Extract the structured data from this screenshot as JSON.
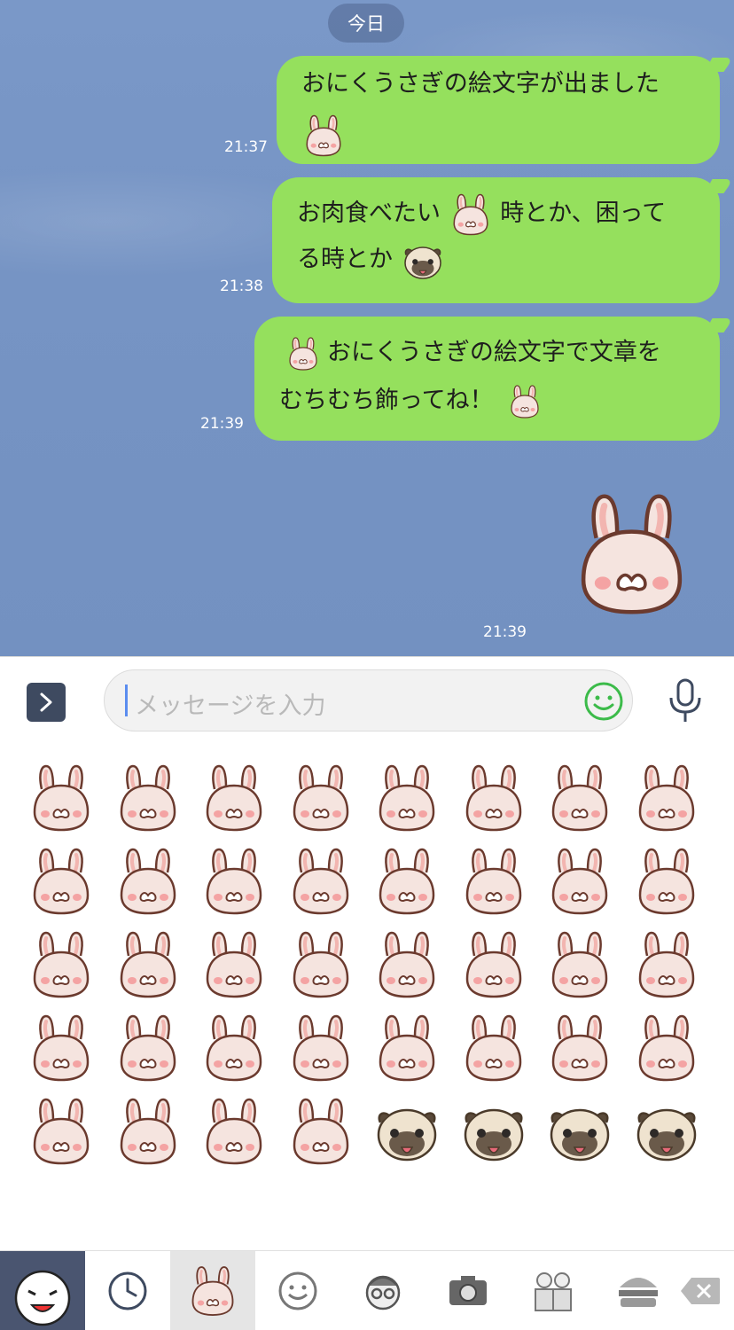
{
  "chat": {
    "date_label": "今日",
    "messages": [
      {
        "line1": "おにくうさぎの絵文字が出ました",
        "time": "21:37"
      },
      {
        "line1a": "お肉食べたい",
        "line1b": "時とか、困って",
        "line2": "る時とか",
        "time": "21:38"
      },
      {
        "line1": "おにくうさぎの絵文字で文章を",
        "line2": "むちむち飾ってね！",
        "time": "21:39"
      },
      {
        "sticker": "bunny-sticker",
        "time": "21:39"
      }
    ]
  },
  "input": {
    "placeholder": "メッセージを入力",
    "expand_icon": "chevron-right-icon",
    "emoji_icon": "smile-icon",
    "mic_icon": "microphone-icon"
  },
  "emoji_grid": {
    "rows": [
      [
        "bunny-plain",
        "bunny-blush",
        "bunny-flowers",
        "bunny-sparkle",
        "bunny-stars",
        "bunny-hug",
        "bunny-tongue",
        "bunny-sleep"
      ],
      [
        "bunny-neutral",
        "bunny-steam",
        "bunny-angry",
        "bunny-punch",
        "bunny-sweat",
        "bunny-drop",
        "bunny-cry",
        "bunny-tears"
      ],
      [
        "bunny-star-tilt",
        "bunny-pow",
        "bunny-shock",
        "bunny-halo",
        "bunny-smug",
        "bunny-dash",
        "bunny-thumb",
        "bunny-peek"
      ],
      [
        "bunny-calm",
        "bunny-soul",
        "bunny-gloom",
        "bunny-lying",
        "bunny-sunglasses",
        "bunny-meat",
        "bunny-run",
        "bunny-roll"
      ],
      [
        "bunny-exclaim",
        "bunny-question",
        "bunny-flop",
        "bunny-sprawl",
        "pug-tongue",
        "pug-halo",
        "pug-shiver",
        "pug-question"
      ]
    ]
  },
  "tabs": [
    {
      "name": "tab-sticker-character",
      "icon": "character-face-icon"
    },
    {
      "name": "tab-recent",
      "icon": "clock-icon"
    },
    {
      "name": "tab-bunny",
      "icon": "bunny-icon"
    },
    {
      "name": "tab-smiley",
      "icon": "smiley-icon"
    },
    {
      "name": "tab-people",
      "icon": "face-glasses-icon"
    },
    {
      "name": "tab-objects",
      "icon": "camera-icon"
    },
    {
      "name": "tab-persons",
      "icon": "persons-icon"
    },
    {
      "name": "tab-food",
      "icon": "burger-icon"
    },
    {
      "name": "tab-delete",
      "icon": "backspace-icon"
    }
  ],
  "colors": {
    "bubble": "#95e05d",
    "chat_bg": "#7694c4",
    "accent_green": "#3cbb4a",
    "bunny_fill": "#f5e4df",
    "bunny_line": "#6b3a2e"
  }
}
